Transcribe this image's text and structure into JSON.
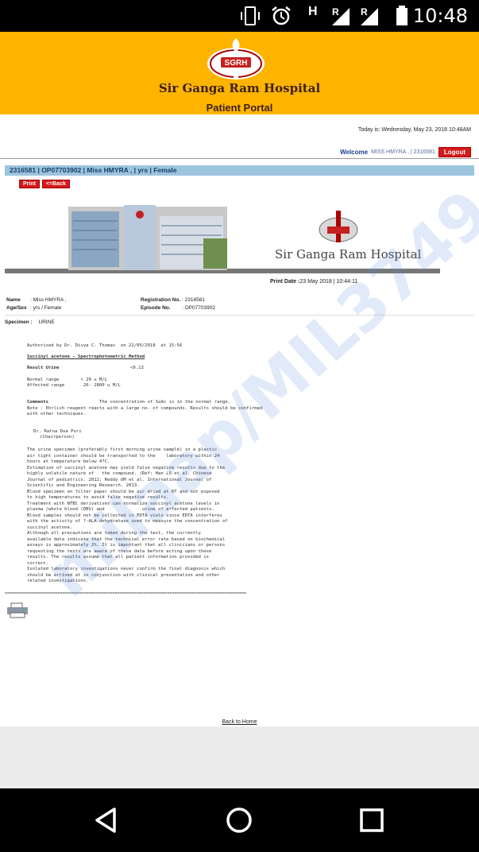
{
  "status_bar": {
    "time": "10:48",
    "signal_label_1": "R",
    "signal_label_2": "R",
    "data_label": "H"
  },
  "header": {
    "logo_text": "SGRH",
    "hospital_name": "Sir Ganga Ram Hospital",
    "portal_title": "Patient Portal",
    "background_color": "#ffb400"
  },
  "session": {
    "today": "Today is: Wednesday, May 23, 2018 10:48AM",
    "welcome_label": "Welcome",
    "welcome_user": "MISS HMYRA , | 2316581",
    "logout_label": "Logout"
  },
  "patient_bar": "2316581 | OP07703902 | Miss HMYRA , | yrs | Female",
  "actions": {
    "print_label": "Print",
    "back_label": "<=Back"
  },
  "banner": {
    "hospital_name": "Sir Ganga Ram Hospital"
  },
  "print_date": {
    "label": "Print Date :",
    "value": "23 May 2018 | 10:44:11"
  },
  "patient_info": {
    "name_label": "Name",
    "name_value": ": Miss HMYRA ,",
    "agesex_label": "Age/Sex",
    "agesex_value": ": yrs / Female",
    "reg_label": "Registration No.",
    "reg_value": ": 2316581",
    "episode_label": "Episode No.",
    "episode_value": ": OP07703902"
  },
  "specimen": {
    "label": "Specimen :",
    "value": "URINE"
  },
  "report": {
    "authorised": "Authorised by Dr. Divya C. Thomas  on 22/05/2018  at 15:56",
    "test_name": "Succinyl acetone - Spectrophotometric Method",
    "result_label": "Result Urine",
    "result_value": "<0.13",
    "normal_range": "Normal range        < 20 u M/L",
    "affected_range": "Affected range       20- 2800 u M/L",
    "comments_label": "Comments",
    "comments_1": "           The concentration of SuAc is in the normal range.",
    "comments_2": "Note : Ehrlich reagent reacts with a large no. of compounds. Results should be confirmed",
    "comments_3": "with other techniques.",
    "doctor_name": "Dr. Ratna Dua Puri",
    "doctor_role": "(Chairperson)",
    "notes": [
      "The urine specimen (preferably first morning urine sample) in a plastic",
      "air tight container should be transported to the    laboratory within 24",
      "hours at temperature below 4?C.",
      "Estimation of succinyl acetone may yield false negative results due to the",
      "highly volatile nature of   the compound. (Ref: Han LS et al. Chinese",
      "Journal of pediatrics. 2012; Reddy UM et al. International Journal of",
      "Scientific and Engineering Research. 2013.",
      "Blood specimen on filter paper should be air dried at RT and not exposed",
      "to high temperatures to avoid false negative results.",
      "Treatment with NTBC derivatives can normalize succinyl acetone levels in",
      "plasma /whole blood (DBS) and              urine of affected patients.",
      "Blood samples should not be collected in EDTA vials since EDTA interferes",
      "with the activity of ?-ALA dehydratase used to measure the concentration of",
      "succinyl acetone.",
      "Although all precautions are taken during the test, the currently",
      "available data indicate that the technical error rate based on biochemical",
      "assays is approximately 2%. It is important that all clinicians or persons",
      "requesting the tests are aware of these data before acting upon these",
      "results. The results assume that all patient information provided is",
      "correct.",
      "Isolated laboratory investigations never confirm the final diagnosis which",
      "should be arrived at in conjunction with clinical presentation and other",
      "related investigations."
    ]
  },
  "separator": "=====================================================================================================",
  "footer": {
    "back_home": "Back to Home"
  },
  "watermark": "milaap/MIL3749"
}
